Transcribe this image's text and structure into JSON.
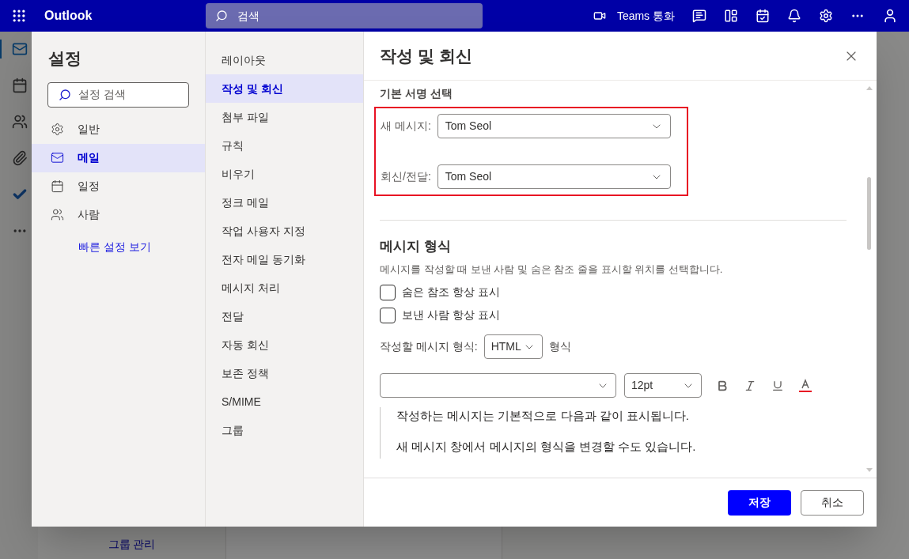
{
  "top_bar": {
    "app_name": "Outlook",
    "search_placeholder": "검색",
    "call_label": "Teams 통화"
  },
  "rail": [
    {
      "kind": "mail",
      "selected": true
    },
    {
      "kind": "calendar",
      "selected": false
    },
    {
      "kind": "people",
      "selected": false
    },
    {
      "kind": "attach",
      "selected": false
    },
    {
      "kind": "todo",
      "selected": false
    },
    {
      "kind": "more",
      "selected": false
    }
  ],
  "background": {
    "link": "그룹 관리"
  },
  "settings": {
    "title": "설정",
    "search_placeholder": "설정 검색",
    "categories": [
      {
        "kind": "general",
        "label": "일반",
        "selected": false
      },
      {
        "kind": "mail",
        "label": "메일",
        "selected": true
      },
      {
        "kind": "calendar",
        "label": "일정",
        "selected": false
      },
      {
        "kind": "people",
        "label": "사람",
        "selected": false
      }
    ],
    "quick_link": "빠른 설정 보기"
  },
  "subcategories": [
    {
      "label": "레이아웃",
      "selected": false
    },
    {
      "label": "작성 및 회신",
      "selected": true
    },
    {
      "label": "첨부 파일",
      "selected": false
    },
    {
      "label": "규칙",
      "selected": false
    },
    {
      "label": "비우기",
      "selected": false
    },
    {
      "label": "정크 메일",
      "selected": false
    },
    {
      "label": "작업 사용자 지정",
      "selected": false
    },
    {
      "label": "전자 메일 동기화",
      "selected": false
    },
    {
      "label": "메시지 처리",
      "selected": false
    },
    {
      "label": "전달",
      "selected": false
    },
    {
      "label": "자동 회신",
      "selected": false
    },
    {
      "label": "보존 정책",
      "selected": false
    },
    {
      "label": "S/MIME",
      "selected": false
    },
    {
      "label": "그룹",
      "selected": false
    }
  ],
  "panel": {
    "title": "작성 및 회신",
    "signature_section": {
      "heading": "기본 서명 선택",
      "highlighted": true,
      "rows": [
        {
          "label": "새 메시지:",
          "value": "Tom Seol"
        },
        {
          "label": "회신/전달:",
          "value": "Tom Seol"
        }
      ]
    },
    "format_section": {
      "heading": "메시지 형식",
      "description": "메시지를 작성할 때 보낸 사람 및 숨은 참조 줄을 표시할 위치를 선택합니다.",
      "checkboxes": [
        {
          "label": "숨은 참조 항상 표시",
          "checked": false
        },
        {
          "label": "보낸 사람 항상 표시",
          "checked": false
        }
      ],
      "compose_format": {
        "label": "작성할 메시지 형식:",
        "value": "HTML",
        "suffix": "형식"
      },
      "font_size": "12pt",
      "preview_lines": [
        "작성하는 메시지는 기본적으로 다음과 같이 표시됩니다.",
        "새 메시지 창에서 메시지의 형식을 변경할 수도 있습니다."
      ]
    },
    "buttons": [
      {
        "kind": "primary",
        "label": "저장"
      },
      {
        "kind": "secondary",
        "label": "취소"
      }
    ]
  }
}
